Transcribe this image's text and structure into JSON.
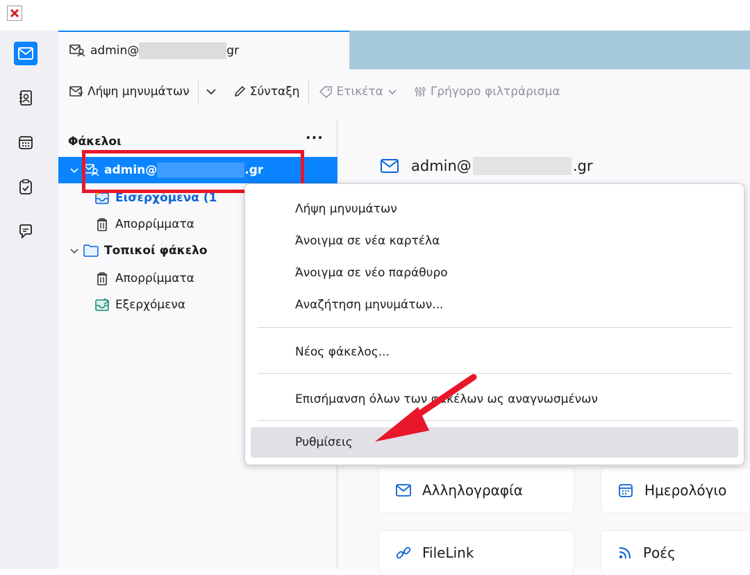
{
  "tab": {
    "title_prefix": "admin@",
    "title_suffix": "gr"
  },
  "toolbar": {
    "get_messages": "Λήψη μηνυμάτων",
    "compose": "Σύνταξη",
    "tag": "Ετικέτα",
    "quick_filter": "Γρήγορο φιλτράρισμα"
  },
  "folders": {
    "header": "Φάκελοι",
    "more": "···",
    "account_prefix": "admin@",
    "account_suffix": ".gr",
    "inbox": "Εισερχόμενα (1",
    "trash_1": "Απορρίμματα",
    "local_folders": "Τοπικοί φάκελο",
    "trash_2": "Απορρίμματα",
    "outbox": "Εξερχόμενα"
  },
  "account_central": {
    "title_prefix": "admin@",
    "title_suffix": ".gr",
    "cards": {
      "mail": "Αλληλογραφία",
      "calendar": "Ημερολόγιο",
      "filelink": "FileLink",
      "feeds": "Ροές"
    }
  },
  "context_menu": {
    "get_messages": "Λήψη μηνυμάτων",
    "open_new_tab": "Άνοιγμα σε νέα καρτέλα",
    "open_new_window": "Άνοιγμα σε νέο παράθυρο",
    "search_messages": "Αναζήτηση μηνυμάτων...",
    "new_folder": "Νέος φάκελος...",
    "mark_all_read": "Επισήμανση όλων των φακέλων ως αναγνωσμένων",
    "settings": "Ρυθμίσεις"
  },
  "colors": {
    "accent": "#0a84ff",
    "highlight_red": "#e8172a"
  }
}
